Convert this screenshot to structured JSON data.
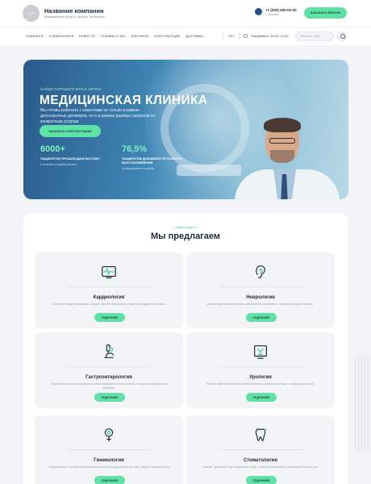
{
  "header": {
    "logo_text": "LOGO",
    "company_name": "Название компании",
    "company_subtitle": "Медицинские услуги, центры, больницы",
    "phone": "+7 (000) 000-00-00",
    "city": "г. Москва",
    "callback_label": "ЗАКАЗАТЬ ЗВОНОК"
  },
  "nav": {
    "items": [
      {
        "label": "ГЛАВНАЯ ▾"
      },
      {
        "label": "О КОМПАНИИ ▾"
      },
      {
        "label": "НОВОСТИ"
      },
      {
        "label": "ОТЗЫВЫ О НАС"
      },
      {
        "label": "КОНТАКТЫ"
      },
      {
        "label": "КОНСУЛЬТАЦИИ"
      },
      {
        "label": "ДОСТАВКА"
      }
    ],
    "lang": "RU",
    "hours": "Ежедневно: 09:00 -21:00",
    "search_placeholder": "Поиск по сайту"
  },
  "hero": {
    "kicker": "НАЙДИ ХОРОШЕГО ВРАЧА ЛЕГКО!",
    "title": "МЕДИЦИНСКАЯ КЛИНИКА",
    "description": "Мы готовы работать с клиентами не только в рамках долгосрочных договоров, но и в рамках разовых запросов по конкретным услугам",
    "cta_label": "ЗАКАЗАТЬ КОНСУЛЬТАЦИЮ",
    "stats": [
      {
        "value": "6000+",
        "label": "ПАЦИЕНТОВ ПРОШЛИ ДИАГНОСТИКУ",
        "sub": "и лечение в нашей клинике"
      },
      {
        "value": "76,5%",
        "label": "ПАЦИЕНТОВ ДОБИВАЮТСЯ ПОЛНОГО ВОССТАНОВЛЕНИЯ",
        "sub": "и возвращаются к жизни"
      }
    ]
  },
  "services": {
    "kicker": "< Наши услуги >",
    "title": "Мы предлагаем",
    "button_label": "ПОДРОБНЕЕ",
    "cards": [
      {
        "title": "Кардиология",
        "desc": "Обширный раздел медицины, который изучает заболевания сердечно-сосудистой системы.",
        "icon": "cardiogram-icon"
      },
      {
        "title": "Неврология",
        "desc": "Диагностика неврологических заболеваний, связанных с нервной системой человека.",
        "icon": "ear-icon"
      },
      {
        "title": "Гастроэнтерология",
        "desc": "Эндоскопическое исследование органов пищеварительной системы с помощью специальных приборов.",
        "icon": "microscope-icon"
      },
      {
        "title": "Урология",
        "desc": "Лечение заболеваний мочеполовой системы у мужчин и женщин, а также диагностика.",
        "icon": "xray-icon"
      },
      {
        "title": "Гинекология",
        "desc": "Профилактика и лечение заболеваний женской репродуктивной системы, ведение беременности.",
        "icon": "gynecology-icon"
      },
      {
        "title": "Стоматология",
        "desc": "Лечение, удаление и протезирование зубов, а также профилактика заболеваний полости рта.",
        "icon": "tooth-icon"
      }
    ]
  },
  "colors": {
    "accent": "#5fe1a8",
    "dark": "#1e2a3a",
    "hero_start": "#2a5a8c"
  }
}
